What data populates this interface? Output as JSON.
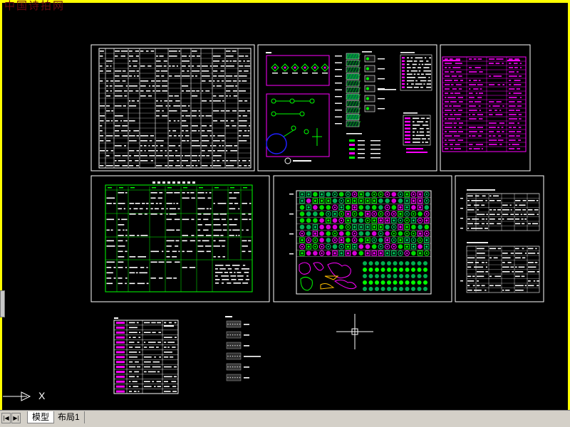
{
  "watermark": "中国诗拍网",
  "tabs": {
    "model": "模型",
    "layout1": "布局1"
  },
  "nav": {
    "first": "|◀",
    "next": "▶|"
  },
  "ucs": {
    "x_label": "X"
  },
  "colors": {
    "background": "#000000",
    "frame": "#ffffff",
    "magenta": "#ff00ff",
    "green": "#00ff00",
    "yellow": "#ffff00",
    "blue": "#2020ff",
    "cyan": "#00c0c0"
  }
}
